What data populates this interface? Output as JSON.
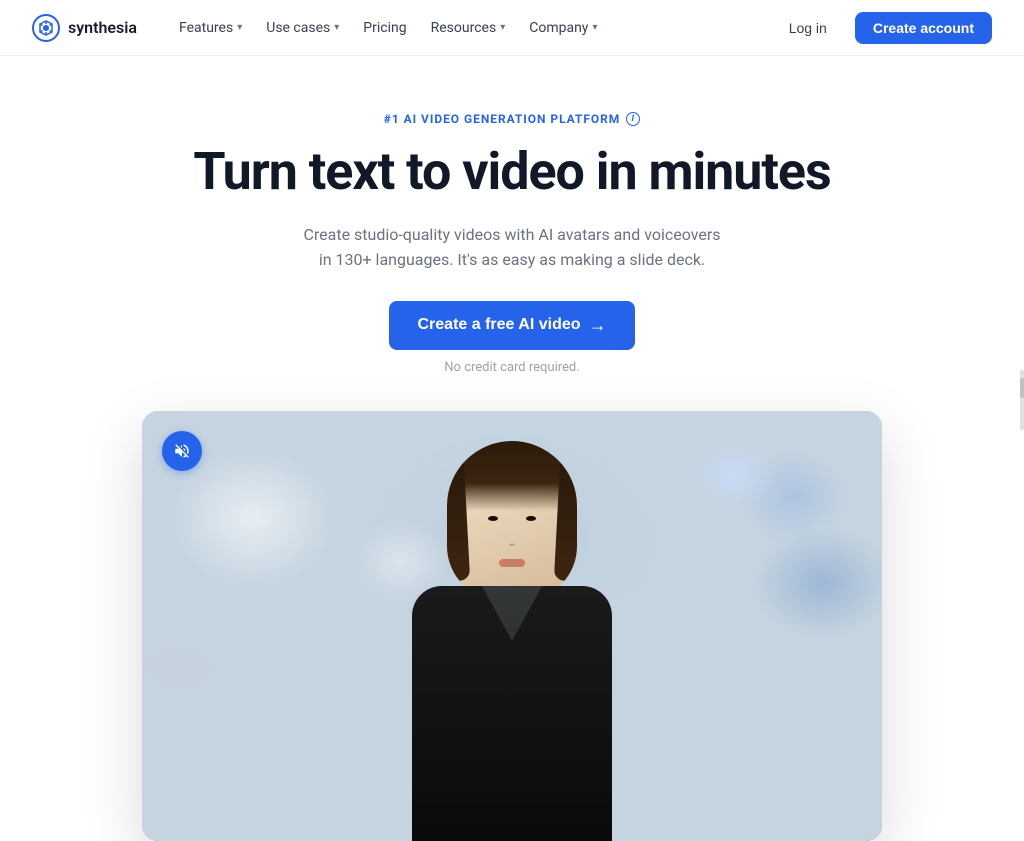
{
  "brand": {
    "name": "synthesia",
    "logo_alt": "Synthesia logo"
  },
  "navbar": {
    "logo_text": "synthesia",
    "features_label": "Features",
    "use_cases_label": "Use cases",
    "pricing_label": "Pricing",
    "resources_label": "Resources",
    "company_label": "Company",
    "login_label": "Log in",
    "create_account_label": "Create account"
  },
  "hero": {
    "badge_text": "#1 AI VIDEO GENERATION PLATFORM",
    "badge_info": "i",
    "title": "Turn text to video in minutes",
    "subtitle": "Create studio-quality videos with AI avatars and voiceovers in 130+ languages. It's as easy as making a slide deck.",
    "cta_label": "Create a free AI video",
    "cta_arrow": "→",
    "no_credit_card": "No credit card required."
  },
  "video": {
    "sound_off_label": "Sound off",
    "mute_icon": "🔇"
  },
  "colors": {
    "primary": "#2563eb",
    "text_dark": "#111827",
    "text_gray": "#6b7280",
    "badge_blue": "#2563eb"
  }
}
